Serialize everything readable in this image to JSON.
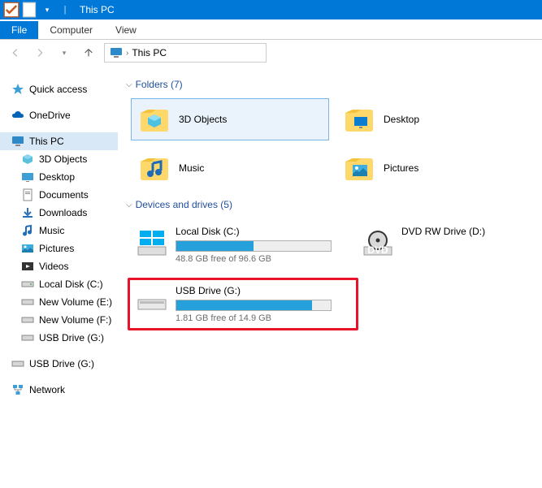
{
  "window": {
    "title": "This PC"
  },
  "ribbon": {
    "file": "File",
    "computer": "Computer",
    "view": "View"
  },
  "breadcrumb": {
    "location": "This PC"
  },
  "sidebar": {
    "quick_access": "Quick access",
    "onedrive": "OneDrive",
    "this_pc": "This PC",
    "items": [
      "3D Objects",
      "Desktop",
      "Documents",
      "Downloads",
      "Music",
      "Pictures",
      "Videos",
      "Local Disk (C:)",
      "New Volume (E:)",
      "New Volume (F:)",
      "USB Drive (G:)"
    ],
    "usb_drive": "USB Drive (G:)",
    "network": "Network"
  },
  "groups": {
    "folders": {
      "label": "Folders (7)"
    },
    "drives": {
      "label": "Devices and drives (5)"
    }
  },
  "folders": [
    {
      "name": "3D Objects"
    },
    {
      "name": "Desktop"
    },
    {
      "name": "Music"
    },
    {
      "name": "Pictures"
    }
  ],
  "drives": [
    {
      "name": "Local Disk (C:)",
      "free": "48.8 GB free of 96.6 GB",
      "fill_pct": 50,
      "kind": "hdd"
    },
    {
      "name": "DVD RW Drive (D:)",
      "free": "",
      "fill_pct": 0,
      "kind": "dvd"
    },
    {
      "name": "USB Drive (G:)",
      "free": "1.81 GB free of 14.9 GB",
      "fill_pct": 88,
      "kind": "usb",
      "highlighted": true
    }
  ]
}
